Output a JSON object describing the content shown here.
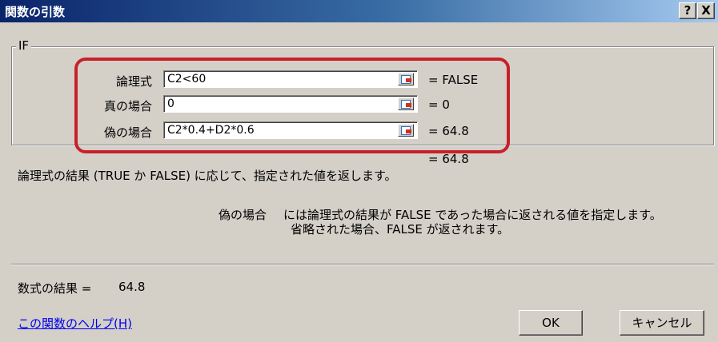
{
  "window": {
    "title": "関数の引数",
    "help_button": "?",
    "close_button": "X"
  },
  "function_name": "IF",
  "arguments": [
    {
      "label": "論理式",
      "value": "C2<60",
      "result": "= FALSE"
    },
    {
      "label": "真の場合",
      "value": "0",
      "result": "= 0"
    },
    {
      "label": "偽の場合",
      "value": "C2*0.4+D2*0.6",
      "result": "= 64.8"
    }
  ],
  "function_result": "= 64.8",
  "description": "論理式の結果 (TRUE か FALSE) に応じて、指定された値を返します。",
  "argument_help": {
    "name": "偽の場合",
    "line1": "には論理式の結果が FALSE であった場合に返される値を指定します。",
    "line2": "省略された場合、FALSE が返されます。"
  },
  "formula_result": {
    "label": "数式の結果 =",
    "value": "64.8"
  },
  "help_link": "この関数のヘルプ(H)",
  "buttons": {
    "ok": "OK",
    "cancel": "キャンセル"
  },
  "colors": {
    "title_start": "#0a246a",
    "title_end": "#a6caf0",
    "highlight": "#c8202a"
  }
}
